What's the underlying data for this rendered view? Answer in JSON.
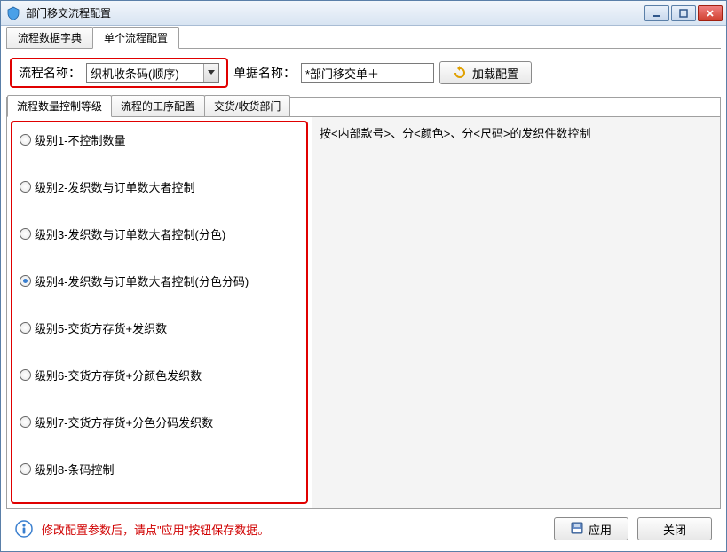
{
  "window": {
    "title": "部门移交流程配置"
  },
  "outer_tabs": [
    {
      "label": "流程数据字典"
    },
    {
      "label": "单个流程配置"
    }
  ],
  "outer_tab_active": 1,
  "config": {
    "process_name_label": "流程名称：",
    "process_name_value": "织机收条码(顺序)",
    "bill_name_label": "单据名称：",
    "bill_name_value": "*部门移交单＋",
    "load_button": "加载配置"
  },
  "inner_tabs": [
    {
      "label": "流程数量控制等级"
    },
    {
      "label": "流程的工序配置"
    },
    {
      "label": "交货/收货部门"
    }
  ],
  "inner_tab_active": 0,
  "radio_options": [
    {
      "label": "级别1-不控制数量",
      "checked": false
    },
    {
      "label": "级别2-发织数与订单数大者控制",
      "checked": false
    },
    {
      "label": "级别3-发织数与订单数大者控制(分色)",
      "checked": false
    },
    {
      "label": "级别4-发织数与订单数大者控制(分色分码)",
      "checked": true
    },
    {
      "label": "级别5-交货方存货+发织数",
      "checked": false
    },
    {
      "label": "级别6-交货方存货+分颜色发织数",
      "checked": false
    },
    {
      "label": "级别7-交货方存货+分色分码发织数",
      "checked": false
    },
    {
      "label": "级别8-条码控制",
      "checked": false
    }
  ],
  "description": "按<内部款号>、分<颜色>、分<尺码>的发织件数控制",
  "footer": {
    "message": "修改配置参数后，请点\"应用\"按钮保存数据。",
    "apply": "应用",
    "close": "关闭"
  }
}
